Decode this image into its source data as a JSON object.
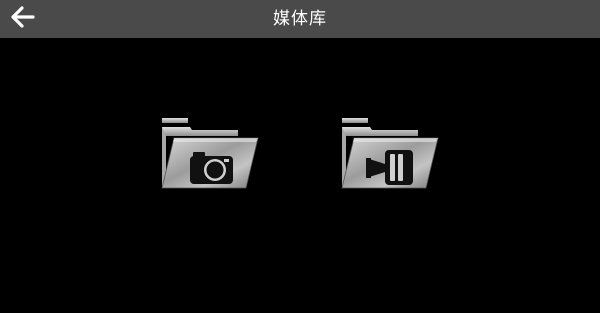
{
  "header": {
    "title": "媒体库",
    "back_icon": "arrow-left-icon",
    "background": "#4a4a4a",
    "text_color": "#ffffff"
  },
  "main": {
    "background": "#000000",
    "folders": [
      {
        "icon": "photo-folder-icon",
        "inner_icon": "camera-icon"
      },
      {
        "icon": "video-folder-icon",
        "inner_icon": "video-camera-icon"
      }
    ]
  }
}
